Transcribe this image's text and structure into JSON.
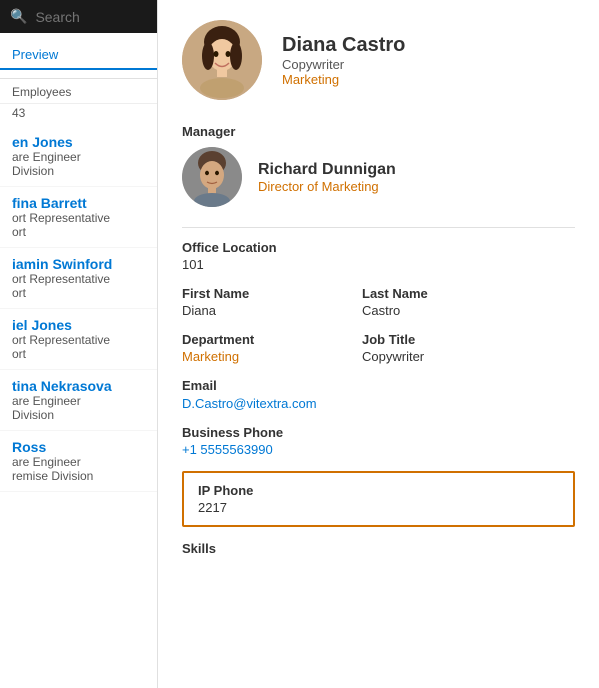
{
  "sidebar": {
    "search": {
      "placeholder": "Search",
      "value": ""
    },
    "nav_items": [
      {
        "label": "Preview",
        "active": true
      }
    ],
    "section_label": "Employees",
    "count": "43",
    "employees": [
      {
        "name": "en Jones",
        "role": "are Engineer",
        "dept": "Division"
      },
      {
        "name": "fina Barrett",
        "role": "ort Representative",
        "dept": "ort"
      },
      {
        "name": "iamin Swinford",
        "role": "ort Representative",
        "dept": "ort"
      },
      {
        "name": "iel Jones",
        "role": "ort Representative",
        "dept": "ort"
      },
      {
        "name": "tina Nekrasova",
        "role": "are Engineer",
        "dept": "Division"
      },
      {
        "name": "Ross",
        "role": "are Engineer",
        "dept": "remise Division"
      }
    ]
  },
  "profile": {
    "name": "Diana Castro",
    "role": "Copywriter",
    "department": "Marketing",
    "manager_label": "Manager",
    "manager": {
      "name": "Richard Dunnigan",
      "title": "Director of Marketing"
    },
    "office_location_label": "Office Location",
    "office_location": "101",
    "first_name_label": "First Name",
    "first_name": "Diana",
    "last_name_label": "Last Name",
    "last_name": "Castro",
    "department_label": "Department",
    "department_value": "Marketing",
    "job_title_label": "Job Title",
    "job_title": "Copywriter",
    "email_label": "Email",
    "email": "D.Castro@vitextra.com",
    "business_phone_label": "Business Phone",
    "business_phone": "+1 5555563990",
    "ip_phone_label": "IP Phone",
    "ip_phone": "2217",
    "skills_label": "Skills"
  }
}
